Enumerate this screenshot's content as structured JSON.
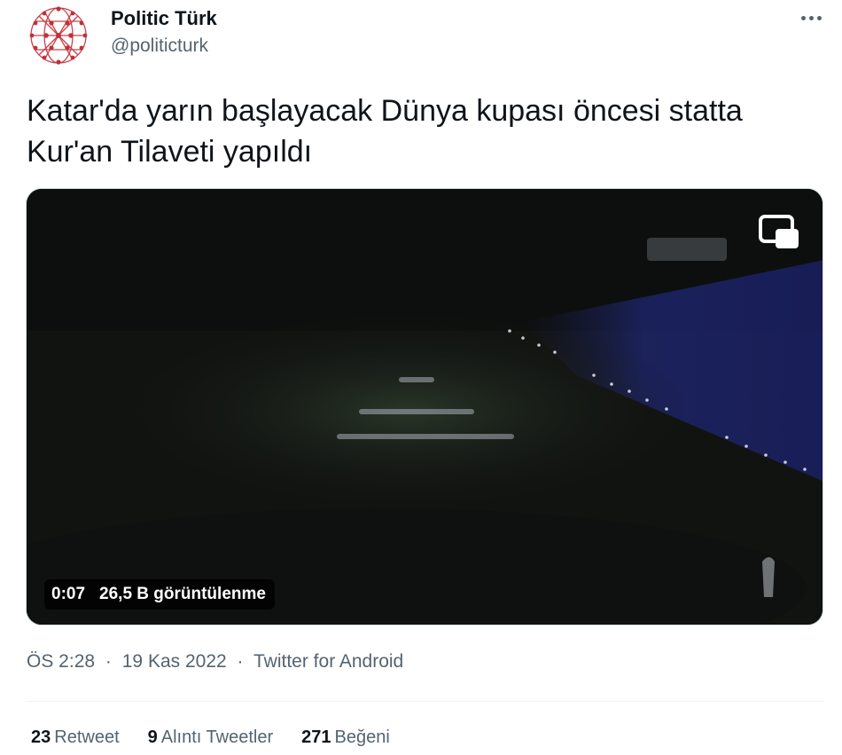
{
  "author": {
    "name": "Politic Türk",
    "handle": "@politicturk",
    "avatar_icon": "network-globe-icon",
    "avatar_color": "#c0303a"
  },
  "tweet": {
    "text": "Katar'da yarın başlayacak Dünya kupası öncesi statta Kur'an Tilaveti yapıldı"
  },
  "video": {
    "elapsed": "0:07",
    "views": "26,5 B görüntülenme",
    "pip_icon": "picture-in-picture-icon"
  },
  "meta": {
    "time": "ÖS 2:28",
    "separator": "·",
    "date": "19 Kas 2022",
    "source": "Twitter for Android"
  },
  "stats": {
    "retweets": {
      "count": "23",
      "label": "Retweet"
    },
    "quotes": {
      "count": "9",
      "label": "Alıntı Tweetler"
    },
    "likes": {
      "count": "271",
      "label": "Beğeni"
    }
  },
  "colors": {
    "text_primary": "#0f1419",
    "text_secondary": "#536471",
    "border": "#cfd9de"
  }
}
